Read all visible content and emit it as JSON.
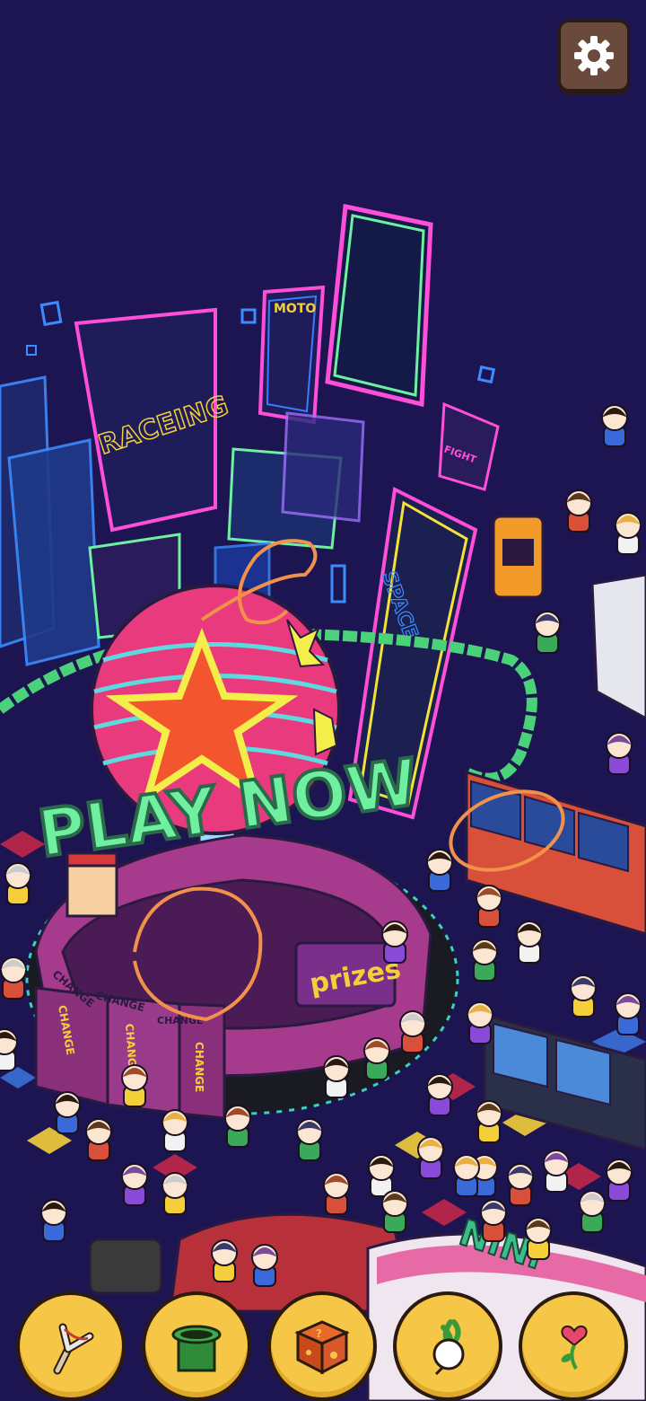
{
  "scene": {
    "play_sign": "PLAY NOW",
    "racing_sign": "RACEING",
    "moto_sign": "MOTO",
    "fight_sign": "FIGHT",
    "space_sign": "SPACE",
    "prizes_sign": "prizes",
    "change_labels": [
      "CHANGE",
      "CHANGE",
      "CHANGE"
    ],
    "change_vertical": [
      "CHANGE",
      "CHANGE",
      "CHANGE"
    ],
    "nini_sign": "NiNi"
  },
  "toolbar": {
    "settings_icon": "gear-icon",
    "buttons": [
      {
        "name": "slingshot-tool-button",
        "icon": "slingshot-icon"
      },
      {
        "name": "pipe-tool-button",
        "icon": "green-pipe-icon"
      },
      {
        "name": "dice-tool-button",
        "icon": "dice-icon"
      },
      {
        "name": "radish-tool-button",
        "icon": "radish-icon"
      },
      {
        "name": "heart-sprout-tool-button",
        "icon": "heart-sprout-icon"
      }
    ]
  },
  "colors": {
    "background": "#1c1552",
    "button_yellow": "#f6c646",
    "neon_pink": "#ff4fd8",
    "neon_green": "#6ef0a0",
    "settings_brown": "#6b4a3e"
  }
}
